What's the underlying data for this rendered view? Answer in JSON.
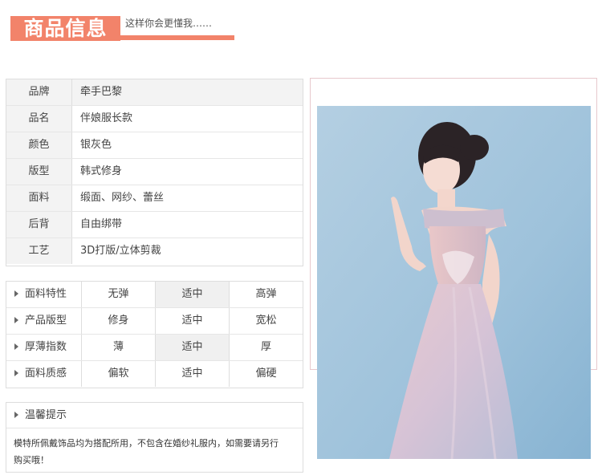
{
  "header": {
    "title": "商品信息",
    "subtitle": "这样你会更懂我……"
  },
  "colors": {
    "accent": "#f2836a",
    "photo_bg": "#a5c5db",
    "dress": "#d9c4d0"
  },
  "info": [
    {
      "key": "品牌",
      "value": "牵手巴黎"
    },
    {
      "key": "品名",
      "value": "伴娘服长款"
    },
    {
      "key": "颜色",
      "value": "银灰色"
    },
    {
      "key": "版型",
      "value": "韩式修身"
    },
    {
      "key": "面料",
      "value": "缎面、网纱、蕾丝"
    },
    {
      "key": "后背",
      "value": "自由绑带"
    },
    {
      "key": "工艺",
      "value": "3D打版/立体剪裁"
    }
  ],
  "attributes": [
    {
      "key": "面料特性",
      "options": [
        "无弹",
        "适中",
        "高弹"
      ]
    },
    {
      "key": "产品版型",
      "options": [
        "修身",
        "适中",
        "宽松"
      ]
    },
    {
      "key": "厚薄指数",
      "options": [
        "薄",
        "适中",
        "厚"
      ]
    },
    {
      "key": "面料质感",
      "options": [
        "偏软",
        "适中",
        "偏硬"
      ]
    }
  ],
  "tips": {
    "title": "温馨提示",
    "line1": "模特所佩戴饰品均为搭配所用，不包含在婚纱礼服内，如需要请另行",
    "line2": "购买哦！"
  },
  "photo": {
    "icon": "model-photo"
  }
}
